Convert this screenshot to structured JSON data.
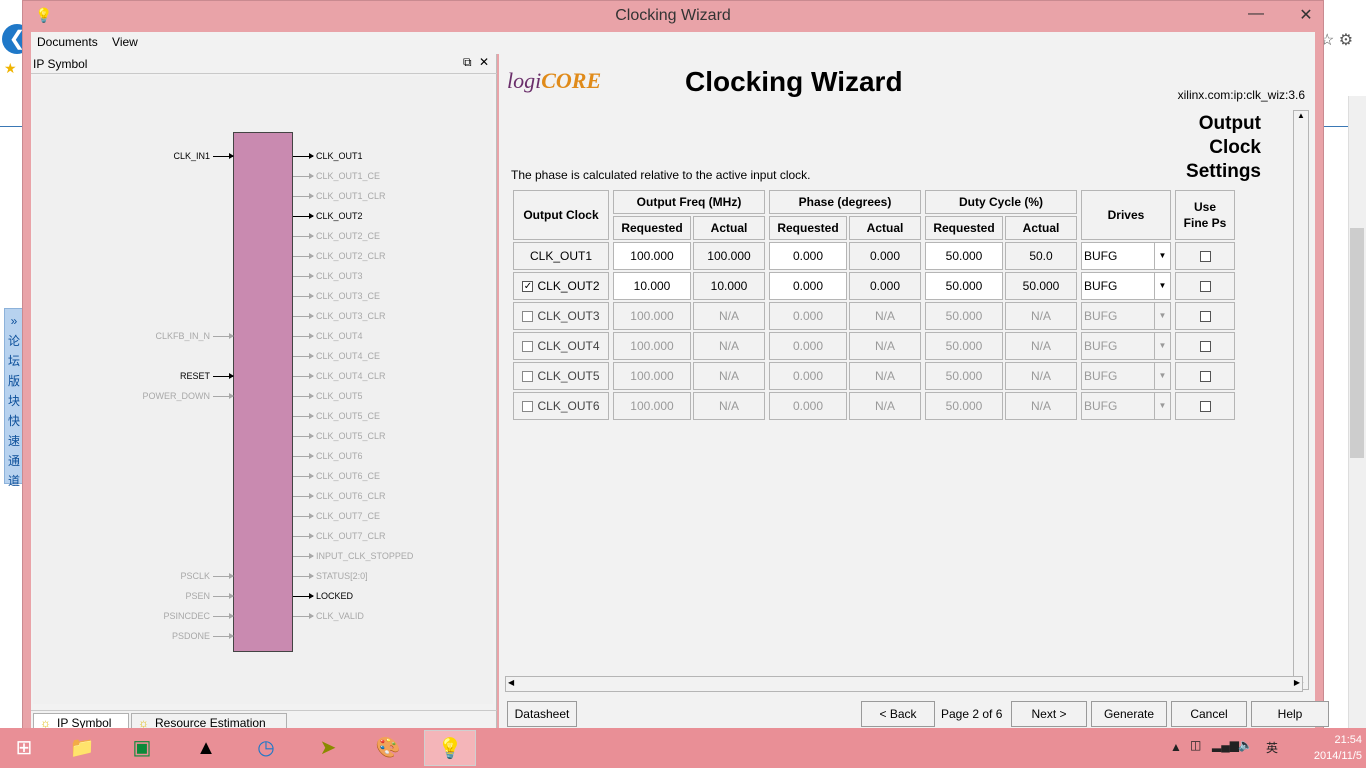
{
  "window": {
    "title": "Clocking Wizard"
  },
  "menu": [
    "Documents",
    "View"
  ],
  "left_panel": {
    "title": "IP Symbol",
    "tabs": [
      "IP Symbol",
      "Resource Estimation"
    ],
    "inputs": [
      {
        "label": "CLK_IN1",
        "active": true
      },
      {
        "label": "CLKFB_IN_N",
        "active": false
      },
      {
        "label": "RESET",
        "active": true
      },
      {
        "label": "POWER_DOWN",
        "active": false
      },
      {
        "label": "PSCLK",
        "active": false
      },
      {
        "label": "PSEN",
        "active": false
      },
      {
        "label": "PSINCDEC",
        "active": false
      },
      {
        "label": "PSDONE",
        "active": false
      }
    ],
    "outputs": [
      {
        "label": "CLK_OUT1",
        "active": true
      },
      {
        "label": "CLK_OUT1_CE",
        "active": false
      },
      {
        "label": "CLK_OUT1_CLR",
        "active": false
      },
      {
        "label": "CLK_OUT2",
        "active": true
      },
      {
        "label": "CLK_OUT2_CE",
        "active": false
      },
      {
        "label": "CLK_OUT2_CLR",
        "active": false
      },
      {
        "label": "CLK_OUT3",
        "active": false
      },
      {
        "label": "CLK_OUT3_CE",
        "active": false
      },
      {
        "label": "CLK_OUT3_CLR",
        "active": false
      },
      {
        "label": "CLK_OUT4",
        "active": false
      },
      {
        "label": "CLK_OUT4_CE",
        "active": false
      },
      {
        "label": "CLK_OUT4_CLR",
        "active": false
      },
      {
        "label": "CLK_OUT5",
        "active": false
      },
      {
        "label": "CLK_OUT5_CE",
        "active": false
      },
      {
        "label": "CLK_OUT5_CLR",
        "active": false
      },
      {
        "label": "CLK_OUT6",
        "active": false
      },
      {
        "label": "CLK_OUT6_CE",
        "active": false
      },
      {
        "label": "CLK_OUT6_CLR",
        "active": false
      },
      {
        "label": "CLK_OUT7_CE",
        "active": false
      },
      {
        "label": "CLK_OUT7_CLR",
        "active": false
      },
      {
        "label": "INPUT_CLK_STOPPED",
        "active": false
      },
      {
        "label": "STATUS[2:0]",
        "active": false
      },
      {
        "label": "LOCKED",
        "active": true
      },
      {
        "label": "CLK_VALID",
        "active": false
      }
    ]
  },
  "right_panel": {
    "logo": {
      "a": "logi",
      "b": "CORE"
    },
    "headline": "Clocking Wizard",
    "core_path": "xilinx.com:ip:clk_wiz:3.6",
    "section_title": [
      "Output",
      "Clock",
      "Settings"
    ],
    "note": "The phase is calculated relative to the active input clock.",
    "table": {
      "headers": {
        "output_clock": "Output Clock",
        "output_freq": "Output Freq (MHz)",
        "phase": "Phase (degrees)",
        "duty": "Duty Cycle (%)",
        "drives": "Drives",
        "use_fine_ps": [
          "Use",
          "Fine Ps"
        ],
        "requested": "Requested",
        "actual": "Actual"
      },
      "rows": [
        {
          "name": "CLK_OUT1",
          "checkbox": null,
          "checked": false,
          "enabled": true,
          "freq_req": "100.000",
          "freq_act": "100.000",
          "phase_req": "0.000",
          "phase_act": "0.000",
          "duty_req": "50.000",
          "duty_act": "50.0",
          "drives": "BUFG"
        },
        {
          "name": "CLK_OUT2",
          "checkbox": true,
          "checked": true,
          "enabled": true,
          "freq_req": "10.000",
          "freq_act": "10.000",
          "phase_req": "0.000",
          "phase_act": "0.000",
          "duty_req": "50.000",
          "duty_act": "50.000",
          "drives": "BUFG"
        },
        {
          "name": "CLK_OUT3",
          "checkbox": true,
          "checked": false,
          "enabled": false,
          "freq_req": "100.000",
          "freq_act": "N/A",
          "phase_req": "0.000",
          "phase_act": "N/A",
          "duty_req": "50.000",
          "duty_act": "N/A",
          "drives": "BUFG"
        },
        {
          "name": "CLK_OUT4",
          "checkbox": true,
          "checked": false,
          "enabled": false,
          "freq_req": "100.000",
          "freq_act": "N/A",
          "phase_req": "0.000",
          "phase_act": "N/A",
          "duty_req": "50.000",
          "duty_act": "N/A",
          "drives": "BUFG"
        },
        {
          "name": "CLK_OUT5",
          "checkbox": true,
          "checked": false,
          "enabled": false,
          "freq_req": "100.000",
          "freq_act": "N/A",
          "phase_req": "0.000",
          "phase_act": "N/A",
          "duty_req": "50.000",
          "duty_act": "N/A",
          "drives": "BUFG"
        },
        {
          "name": "CLK_OUT6",
          "checkbox": true,
          "checked": false,
          "enabled": false,
          "freq_req": "100.000",
          "freq_act": "N/A",
          "phase_req": "0.000",
          "phase_act": "N/A",
          "duty_req": "50.000",
          "duty_act": "N/A",
          "drives": "BUFG"
        }
      ]
    },
    "footer": {
      "datasheet": "Datasheet",
      "back": "< Back",
      "page": "Page 2 of 6",
      "next": "Next >",
      "generate": "Generate",
      "cancel": "Cancel",
      "help": "Help"
    }
  },
  "background_browser": {
    "side_tab_chars": [
      "»",
      "论",
      "坛",
      "版",
      "块",
      "快",
      "速",
      "通",
      "道"
    ]
  },
  "taskbar": {
    "items": [
      "start-icon",
      "file-explorer-icon",
      "store-icon",
      "game-icon",
      "ie-icon",
      "arrow-app-icon",
      "paint-icon",
      "bulb-app-icon"
    ],
    "tray_lang": "英",
    "time": "21:54",
    "date": "2014/11/5"
  }
}
